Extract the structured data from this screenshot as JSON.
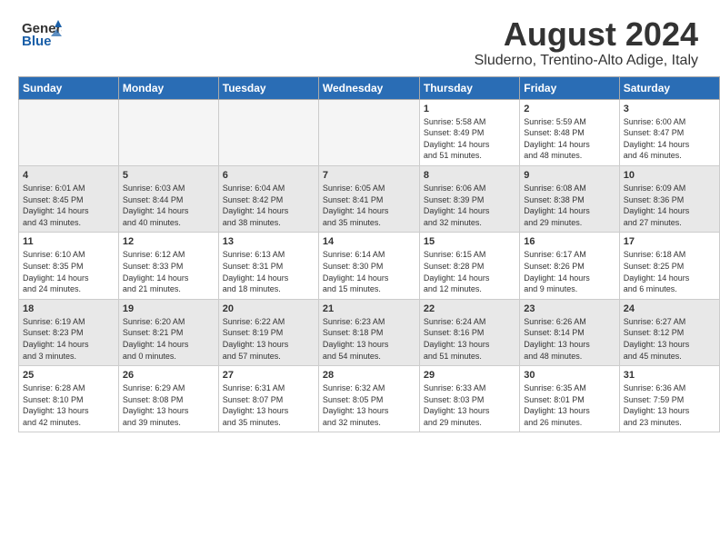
{
  "header": {
    "logo_general": "General",
    "logo_blue": "Blue",
    "month": "August 2024",
    "location": "Sluderno, Trentino-Alto Adige, Italy"
  },
  "days_of_week": [
    "Sunday",
    "Monday",
    "Tuesday",
    "Wednesday",
    "Thursday",
    "Friday",
    "Saturday"
  ],
  "weeks": [
    [
      {
        "day": "",
        "info": ""
      },
      {
        "day": "",
        "info": ""
      },
      {
        "day": "",
        "info": ""
      },
      {
        "day": "",
        "info": ""
      },
      {
        "day": "1",
        "info": "Sunrise: 5:58 AM\nSunset: 8:49 PM\nDaylight: 14 hours\nand 51 minutes."
      },
      {
        "day": "2",
        "info": "Sunrise: 5:59 AM\nSunset: 8:48 PM\nDaylight: 14 hours\nand 48 minutes."
      },
      {
        "day": "3",
        "info": "Sunrise: 6:00 AM\nSunset: 8:47 PM\nDaylight: 14 hours\nand 46 minutes."
      }
    ],
    [
      {
        "day": "4",
        "info": "Sunrise: 6:01 AM\nSunset: 8:45 PM\nDaylight: 14 hours\nand 43 minutes."
      },
      {
        "day": "5",
        "info": "Sunrise: 6:03 AM\nSunset: 8:44 PM\nDaylight: 14 hours\nand 40 minutes."
      },
      {
        "day": "6",
        "info": "Sunrise: 6:04 AM\nSunset: 8:42 PM\nDaylight: 14 hours\nand 38 minutes."
      },
      {
        "day": "7",
        "info": "Sunrise: 6:05 AM\nSunset: 8:41 PM\nDaylight: 14 hours\nand 35 minutes."
      },
      {
        "day": "8",
        "info": "Sunrise: 6:06 AM\nSunset: 8:39 PM\nDaylight: 14 hours\nand 32 minutes."
      },
      {
        "day": "9",
        "info": "Sunrise: 6:08 AM\nSunset: 8:38 PM\nDaylight: 14 hours\nand 29 minutes."
      },
      {
        "day": "10",
        "info": "Sunrise: 6:09 AM\nSunset: 8:36 PM\nDaylight: 14 hours\nand 27 minutes."
      }
    ],
    [
      {
        "day": "11",
        "info": "Sunrise: 6:10 AM\nSunset: 8:35 PM\nDaylight: 14 hours\nand 24 minutes."
      },
      {
        "day": "12",
        "info": "Sunrise: 6:12 AM\nSunset: 8:33 PM\nDaylight: 14 hours\nand 21 minutes."
      },
      {
        "day": "13",
        "info": "Sunrise: 6:13 AM\nSunset: 8:31 PM\nDaylight: 14 hours\nand 18 minutes."
      },
      {
        "day": "14",
        "info": "Sunrise: 6:14 AM\nSunset: 8:30 PM\nDaylight: 14 hours\nand 15 minutes."
      },
      {
        "day": "15",
        "info": "Sunrise: 6:15 AM\nSunset: 8:28 PM\nDaylight: 14 hours\nand 12 minutes."
      },
      {
        "day": "16",
        "info": "Sunrise: 6:17 AM\nSunset: 8:26 PM\nDaylight: 14 hours\nand 9 minutes."
      },
      {
        "day": "17",
        "info": "Sunrise: 6:18 AM\nSunset: 8:25 PM\nDaylight: 14 hours\nand 6 minutes."
      }
    ],
    [
      {
        "day": "18",
        "info": "Sunrise: 6:19 AM\nSunset: 8:23 PM\nDaylight: 14 hours\nand 3 minutes."
      },
      {
        "day": "19",
        "info": "Sunrise: 6:20 AM\nSunset: 8:21 PM\nDaylight: 14 hours\nand 0 minutes."
      },
      {
        "day": "20",
        "info": "Sunrise: 6:22 AM\nSunset: 8:19 PM\nDaylight: 13 hours\nand 57 minutes."
      },
      {
        "day": "21",
        "info": "Sunrise: 6:23 AM\nSunset: 8:18 PM\nDaylight: 13 hours\nand 54 minutes."
      },
      {
        "day": "22",
        "info": "Sunrise: 6:24 AM\nSunset: 8:16 PM\nDaylight: 13 hours\nand 51 minutes."
      },
      {
        "day": "23",
        "info": "Sunrise: 6:26 AM\nSunset: 8:14 PM\nDaylight: 13 hours\nand 48 minutes."
      },
      {
        "day": "24",
        "info": "Sunrise: 6:27 AM\nSunset: 8:12 PM\nDaylight: 13 hours\nand 45 minutes."
      }
    ],
    [
      {
        "day": "25",
        "info": "Sunrise: 6:28 AM\nSunset: 8:10 PM\nDaylight: 13 hours\nand 42 minutes."
      },
      {
        "day": "26",
        "info": "Sunrise: 6:29 AM\nSunset: 8:08 PM\nDaylight: 13 hours\nand 39 minutes."
      },
      {
        "day": "27",
        "info": "Sunrise: 6:31 AM\nSunset: 8:07 PM\nDaylight: 13 hours\nand 35 minutes."
      },
      {
        "day": "28",
        "info": "Sunrise: 6:32 AM\nSunset: 8:05 PM\nDaylight: 13 hours\nand 32 minutes."
      },
      {
        "day": "29",
        "info": "Sunrise: 6:33 AM\nSunset: 8:03 PM\nDaylight: 13 hours\nand 29 minutes."
      },
      {
        "day": "30",
        "info": "Sunrise: 6:35 AM\nSunset: 8:01 PM\nDaylight: 13 hours\nand 26 minutes."
      },
      {
        "day": "31",
        "info": "Sunrise: 6:36 AM\nSunset: 7:59 PM\nDaylight: 13 hours\nand 23 minutes."
      }
    ]
  ]
}
